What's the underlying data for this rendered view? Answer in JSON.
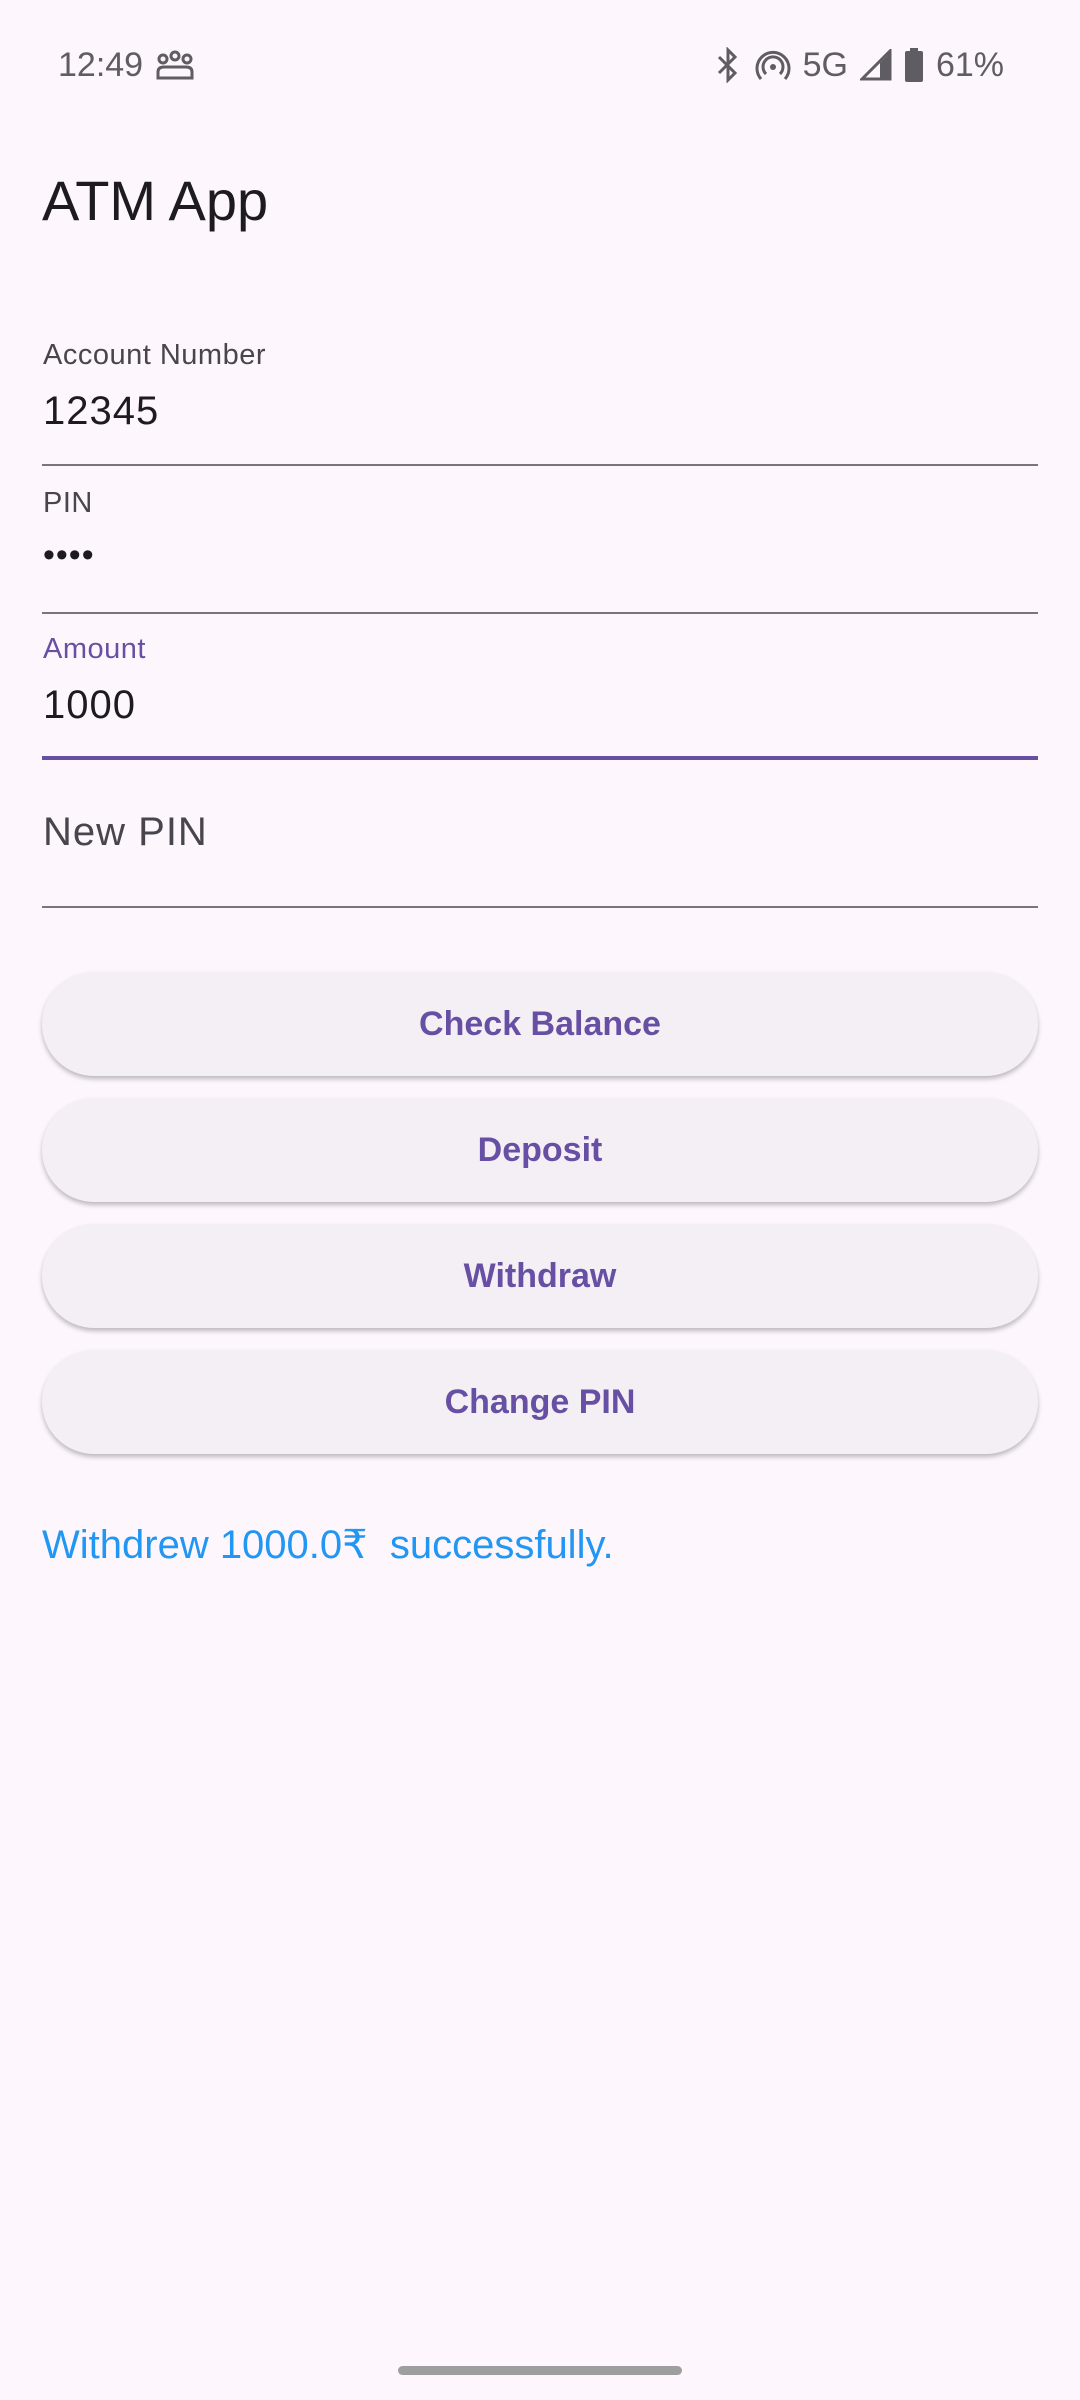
{
  "status_bar": {
    "time": "12:49",
    "network": "5G",
    "battery": "61%",
    "icons": [
      "people-icon",
      "bluetooth-icon",
      "hotspot-icon",
      "signal-icon",
      "battery-icon"
    ]
  },
  "app_bar": {
    "title": "ATM App"
  },
  "form": {
    "account_number": {
      "label": "Account Number",
      "value": "12345"
    },
    "pin": {
      "label": "PIN",
      "value": "••••"
    },
    "amount": {
      "label": "Amount",
      "value": "1000"
    },
    "new_pin": {
      "placeholder": "New PIN"
    }
  },
  "buttons": {
    "check_balance": "Check Balance",
    "deposit": "Deposit",
    "withdraw": "Withdraw",
    "change_pin": "Change PIN"
  },
  "message": "Withdrew 1000.0₹  successfully.",
  "colors": {
    "accent": "#6750a4",
    "message": "#2196f3",
    "background": "#fdf7fd"
  }
}
